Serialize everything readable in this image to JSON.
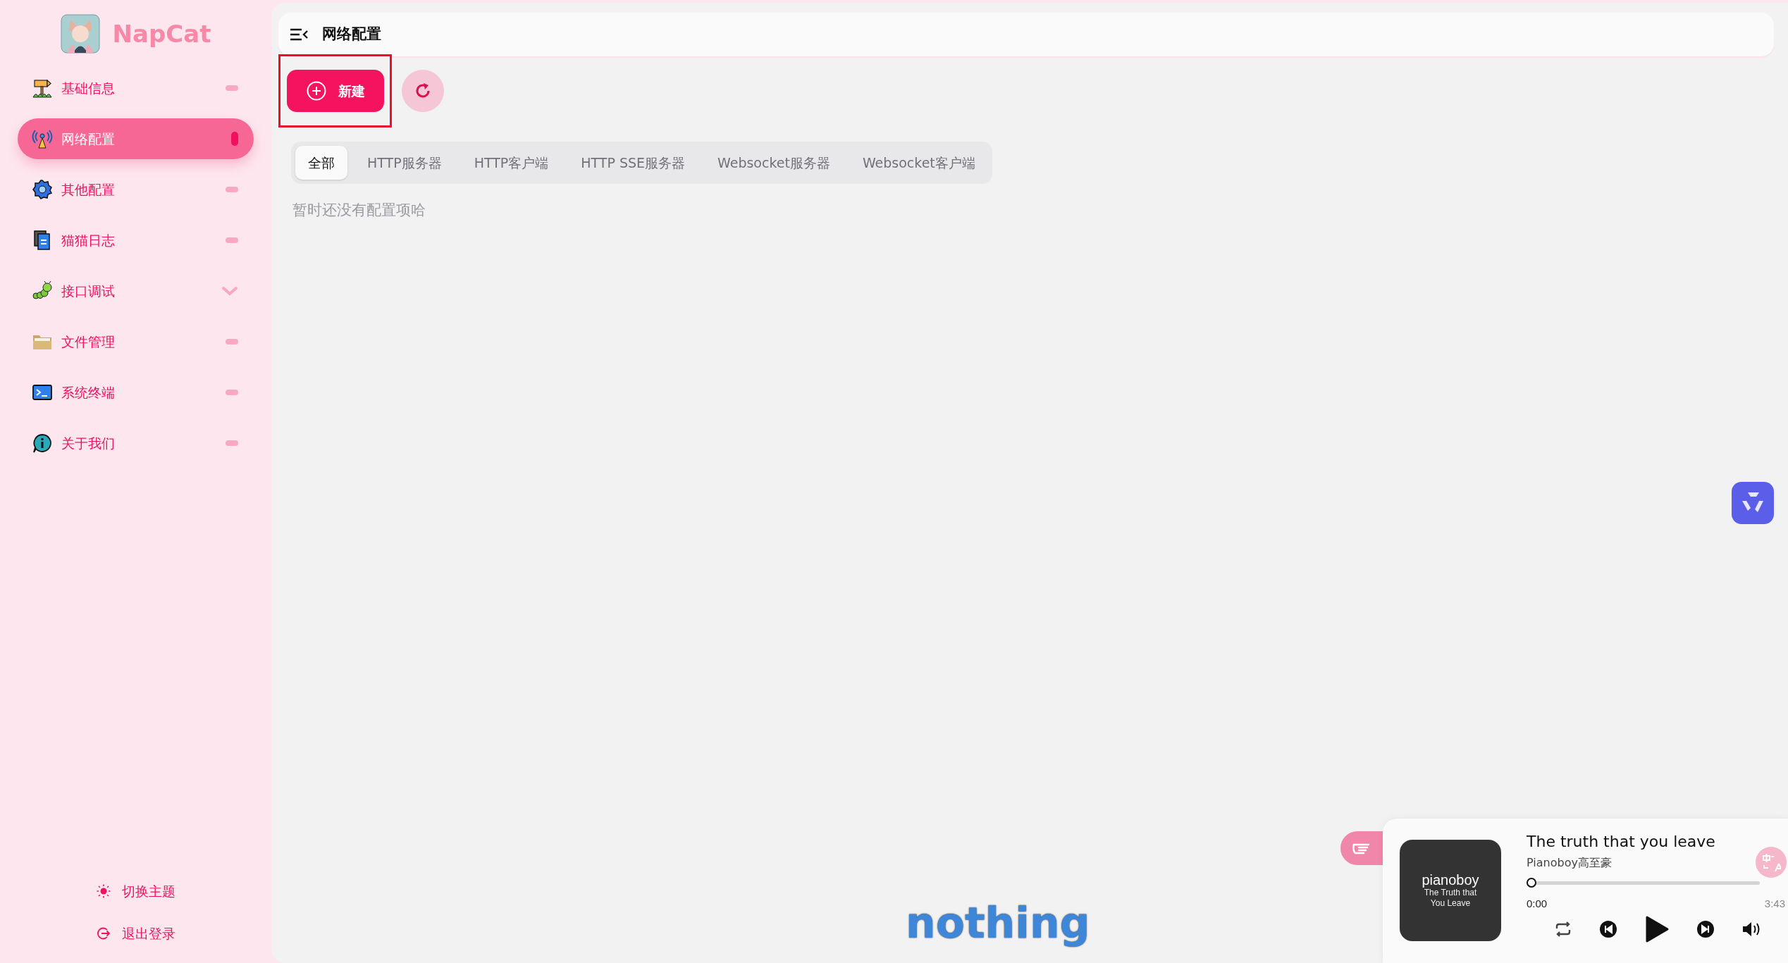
{
  "app": {
    "name": "NapCat"
  },
  "nav": [
    {
      "label": "基础信息",
      "selected": false,
      "kind": "dash"
    },
    {
      "label": "网络配置",
      "selected": true,
      "kind": "dash"
    },
    {
      "label": "其他配置",
      "selected": false,
      "kind": "dash"
    },
    {
      "label": "猫猫日志",
      "selected": false,
      "kind": "dash"
    },
    {
      "label": "接口调试",
      "selected": false,
      "kind": "chevron"
    },
    {
      "label": "文件管理",
      "selected": false,
      "kind": "dash"
    },
    {
      "label": "系统终端",
      "selected": false,
      "kind": "dash"
    },
    {
      "label": "关于我们",
      "selected": false,
      "kind": "dash"
    }
  ],
  "footer_actions": [
    {
      "label": "切换主题",
      "kind": "theme"
    },
    {
      "label": "退出登录",
      "kind": "logout"
    }
  ],
  "header": {
    "title": "网络配置"
  },
  "toolbar": {
    "new_button": "新建"
  },
  "filter_tabs": [
    {
      "label": "全部",
      "selected": true
    },
    {
      "label": "HTTP服务器",
      "selected": false
    },
    {
      "label": "HTTP客户端",
      "selected": false
    },
    {
      "label": "HTTP SSE服务器",
      "selected": false
    },
    {
      "label": "Websocket服务器",
      "selected": false
    },
    {
      "label": "Websocket客户端",
      "selected": false
    }
  ],
  "empty_message": "暂时还没有配置项哈",
  "player": {
    "title": "The truth that you leave",
    "artist": "Pianoboy高至豪",
    "cover_lines": [
      "pianoboy",
      "The Truth that",
      "You Leave"
    ],
    "elapsed": "0:00",
    "duration": "3:43",
    "level": 0
  },
  "overlay_text": "nothing"
}
